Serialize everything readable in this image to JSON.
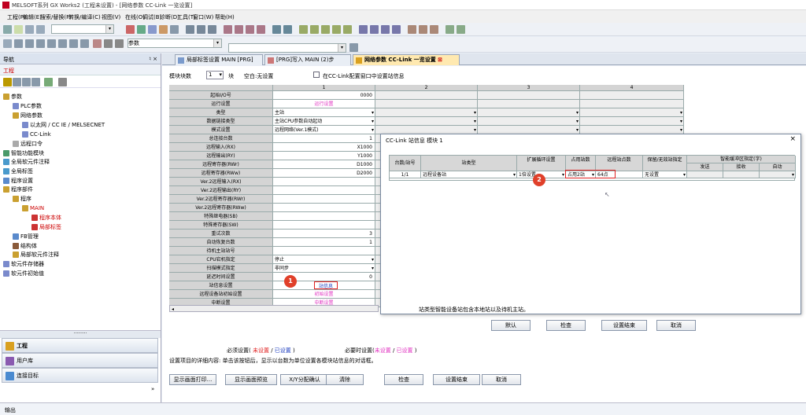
{
  "window": {
    "title": "MELSOFT系列 GX Works2 (工程未设置) - [网络参数 CC-Link 一览设置]"
  },
  "menu": [
    "工程(P)",
    "编辑(E)",
    "搜索/替换(F)",
    "转换/编译(C)",
    "视图(V)",
    "在线(O)",
    "调试(B)",
    "诊断(D)",
    "工具(T)",
    "窗口(W)",
    "帮助(H)"
  ],
  "toolbar": {
    "combo_label": "参数"
  },
  "nav": {
    "title": "导航",
    "pin": "♮ ×",
    "project_label": "工程",
    "tree": [
      "参数",
      "PLC参数",
      "网络参数",
      "以太网 / CC IE / MELSECNET",
      "CC-Link",
      "远程口令",
      "智能功能模块",
      "全局软元件注释",
      "全局标签",
      "程序设置",
      "程序部件",
      "程序",
      "MAIN",
      "程序本体",
      "局部标签",
      "FB管理",
      "结构体",
      "局部软元件注释",
      "软元件存储器",
      "软元件初始值"
    ],
    "buttons": [
      "工程",
      "用户库",
      "连接目标"
    ]
  },
  "tabs": [
    "局部标签设置 MAIN [PRG]",
    "[PRG]写入 MAIN (2)步",
    "网络参数 CC-Link 一览设置"
  ],
  "header": {
    "module_count_label": "模块块数",
    "module_count": "1",
    "unit": "块",
    "empty_label": "空白:无设置",
    "checkbox_label": "在CC-Link配置窗口中设置站信息"
  },
  "grid": {
    "columns": [
      "1",
      "2",
      "3",
      "4"
    ],
    "rows": [
      {
        "label": "起始I/O号",
        "v": "0000",
        "align": "right"
      },
      {
        "label": "运行设置",
        "v": "运行设置",
        "pink": true
      },
      {
        "label": "类型",
        "v": "主站",
        "dd": true
      },
      {
        "label": "数据链接类型",
        "v": "主站CPU参数自动起动",
        "dd": true
      },
      {
        "label": "模式设置",
        "v": "远程网络(Ver.1模式)",
        "dd": true
      },
      {
        "label": "总连接台数",
        "v": "1",
        "align": "right"
      },
      {
        "label": "远程输入(RX)",
        "v": "X1000",
        "align": "right"
      },
      {
        "label": "远程输出(RY)",
        "v": "Y1000",
        "align": "right"
      },
      {
        "label": "远程寄存器(RWr)",
        "v": "D1000",
        "align": "right"
      },
      {
        "label": "远程寄存器(RWw)",
        "v": "D2000",
        "align": "right"
      },
      {
        "label": "Ver.2远程输入(RX)",
        "v": ""
      },
      {
        "label": "Ver.2远程输出(RY)",
        "v": ""
      },
      {
        "label": "Ver.2远程寄存器(RWr)",
        "v": ""
      },
      {
        "label": "Ver.2远程寄存器(RWw)",
        "v": ""
      },
      {
        "label": "特殊继电器(SB)",
        "v": ""
      },
      {
        "label": "特殊寄存器(SW)",
        "v": ""
      },
      {
        "label": "重试次数",
        "v": "3",
        "align": "right"
      },
      {
        "label": "自动恢复台数",
        "v": "1",
        "align": "right"
      },
      {
        "label": "待机主站站号",
        "v": ""
      },
      {
        "label": "CPU宕机指定",
        "v": "停止",
        "dd": true
      },
      {
        "label": "扫描模式指定",
        "v": "非同步",
        "dd": true
      },
      {
        "label": "延迟时间设置",
        "v": "0",
        "align": "right"
      },
      {
        "label": "站信息设置",
        "v": "站信息",
        "box": true
      },
      {
        "label": "远程设备站初始设置",
        "v": "初始设置",
        "pink": true
      },
      {
        "label": "中断设置",
        "v": "中断设置",
        "pink": true
      }
    ]
  },
  "legend": {
    "required": "必须设置(",
    "not_set": "未设置",
    "sep": "/",
    "set": "已设置",
    "close": ")",
    "needed": "必要时设置(",
    "line2": "设置项目的详细内容: 单击该按钮后，显示以台数为单位设置各模块站信息的对话框。"
  },
  "bottom_buttons": [
    "显示画面打印...",
    "显示画面预览",
    "X/Y分配确认",
    "清除",
    "检查",
    "设置结束",
    "取消"
  ],
  "dialog": {
    "title": "CC-Link 站信息 模块 1",
    "close": "×",
    "headers": [
      "台数/站号",
      "站类型",
      "扩展循环设置",
      "占用站数",
      "远程站点数",
      "保留/无效站指定",
      "智能缓冲区指定(字)",
      "发送",
      "接收",
      "自动"
    ],
    "row": [
      "1/1",
      "远程设备站",
      "1倍设置",
      "占用2站",
      "64点",
      "无设置",
      "",
      "",
      ""
    ],
    "note": "站类型智能设备站包含本地站以及待机主站。",
    "buttons": [
      "默认",
      "检查",
      "设置结束",
      "取消"
    ]
  },
  "badges": [
    "1",
    "2"
  ],
  "status": {
    "label": "输出"
  },
  "colors": {
    "pink": "#e030c0",
    "red_badge": "#e0402a",
    "active_tab": "#ffe9b0"
  }
}
